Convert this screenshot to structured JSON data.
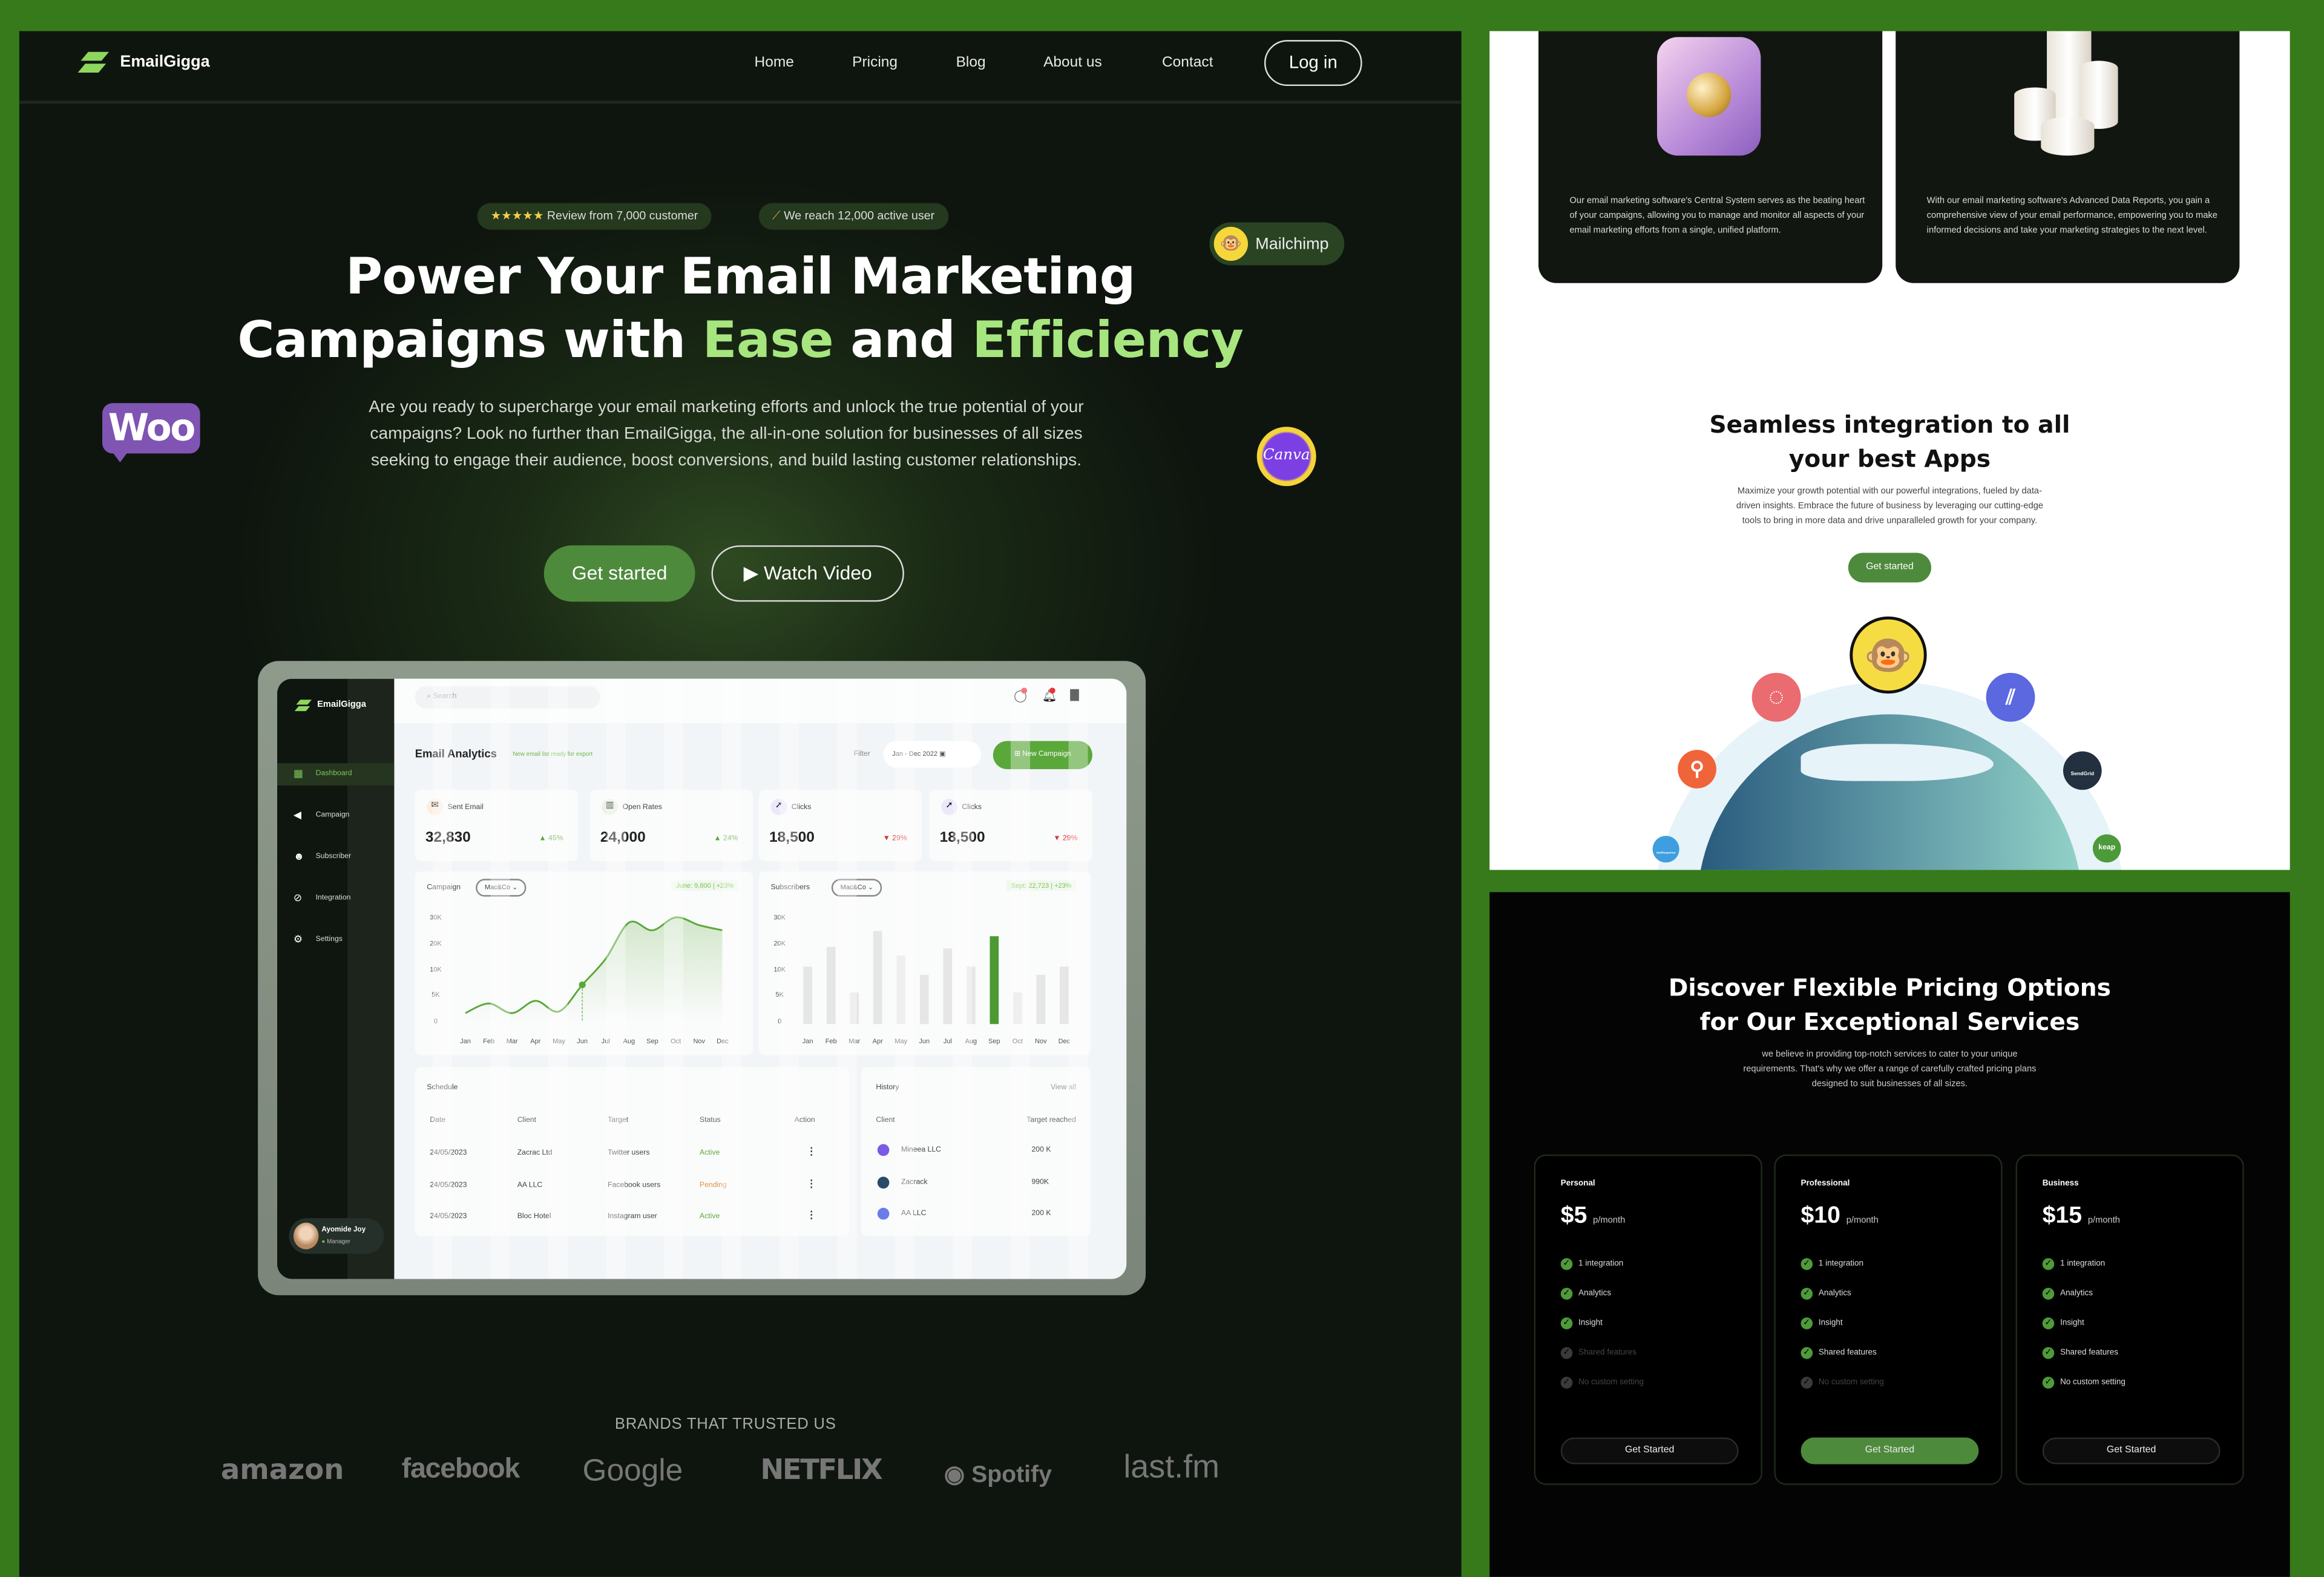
{
  "colors": {
    "page_bg": "#367a1b",
    "accent_green": "#a7e57e",
    "button_green": "#4e8a3c",
    "hero_bg": "#0e150e"
  },
  "nav": {
    "brand": "EmailGigga",
    "links": [
      "Home",
      "Pricing",
      "Blog",
      "About us",
      "Contact"
    ],
    "login": "Log in"
  },
  "hero": {
    "badge_reviews": {
      "stars": "★★★★★",
      "text": "Review from 7,000 customer"
    },
    "badge_users": {
      "icon": "party-popper-icon",
      "text": "We reach 12,000 active user"
    },
    "title_line1": "Power Your Email Marketing",
    "title_line2_a": "Campaigns with ",
    "title_ease": "Ease",
    "title_and": " and ",
    "title_efficiency": "Efficiency",
    "paragraph": "Are you ready to supercharge your email marketing efforts and unlock the true potential of your campaigns? Look no further than EmailGigga, the all-in-one solution for businesses of all sizes seeking to engage their audience, boost conversions, and build lasting customer relationships.",
    "get_started": "Get started",
    "watch_video": "Watch Video",
    "floating": {
      "mailchimp": "Mailchimp",
      "woo": "Woo",
      "canva": "Canva"
    }
  },
  "dashboard": {
    "brand": "EmailGigga",
    "search_placeholder": "Search",
    "sidebar": [
      {
        "label": "Dashboard",
        "icon": "grid-icon",
        "active": true
      },
      {
        "label": "Campaign",
        "icon": "megaphone-icon"
      },
      {
        "label": "Subscriber",
        "icon": "users-icon"
      },
      {
        "label": "Integration",
        "icon": "link-icon"
      },
      {
        "label": "Settings",
        "icon": "gear-icon"
      }
    ],
    "user": {
      "name": "Ayomide Joy",
      "role": "Manager"
    },
    "title": "Email Analytics",
    "notice": "New email list ready for export",
    "filter_label": "Filter",
    "date_range": "Jan - Dec 2022",
    "new_campaign": "New Campaign",
    "stats": [
      {
        "label": "Sent Email",
        "value": "32,830",
        "change": "▲ 45%",
        "trend": "up"
      },
      {
        "label": "Open Rates",
        "value": "24,000",
        "change": "▲ 24%",
        "trend": "up"
      },
      {
        "label": "Clicks",
        "value": "18,500",
        "change": "▼ 29%",
        "trend": "down"
      },
      {
        "label": "Clicks",
        "value": "18,500",
        "change": "▼ 29%",
        "trend": "down"
      }
    ],
    "schedule": {
      "title": "Schedule",
      "columns": [
        "Date",
        "Client",
        "Target",
        "Status",
        "Action"
      ],
      "rows": [
        [
          "24/05/2023",
          "Zacrac Ltd",
          "Twitter users",
          "Active"
        ],
        [
          "24/05/2023",
          "AA LLC",
          "Facebook users",
          "Pending"
        ],
        [
          "24/05/2023",
          "Bloc Hotel",
          "Instagram user",
          "Active"
        ]
      ]
    },
    "history": {
      "title": "History",
      "view_all": "View all",
      "columns": [
        "Client",
        "Target reached"
      ],
      "rows": [
        [
          "Mineea LLC",
          "200 K"
        ],
        [
          "Zacrack",
          "990K"
        ],
        [
          "AA LLC",
          "200 K"
        ]
      ]
    }
  },
  "chart_data": [
    {
      "type": "area",
      "title": "Campaign",
      "dropdown": "Mac&Co",
      "annotation": "June: 9,800 | +23%",
      "categories": [
        "Jan",
        "Feb",
        "Mar",
        "Apr",
        "May",
        "Jun",
        "Jul",
        "Aug",
        "Sep",
        "Oct",
        "Nov",
        "Dec"
      ],
      "values": [
        1500,
        3300,
        1500,
        3800,
        1800,
        6900,
        14000,
        28000,
        25000,
        30000,
        27000,
        25000
      ],
      "yticks": [
        "0",
        "5K",
        "10K",
        "20K",
        "30K"
      ],
      "ylim": [
        0,
        30000
      ],
      "highlight": "Jun",
      "color": "#5aa83a"
    },
    {
      "type": "bar",
      "title": "Subscribers",
      "dropdown": "Mac&Co",
      "annotation": "Sept: 22,723 | +23%",
      "categories": [
        "Jan",
        "Feb",
        "Mar",
        "Apr",
        "May",
        "Jun",
        "Jul",
        "Aug",
        "Sep",
        "Oct",
        "Nov",
        "Dec"
      ],
      "values": [
        11000,
        18600,
        5400,
        24700,
        15300,
        8900,
        18000,
        11000,
        22723,
        5400,
        8900,
        11000
      ],
      "yticks": [
        "0",
        "5K",
        "10K",
        "20K",
        "30K"
      ],
      "ylim": [
        0,
        30000
      ],
      "highlight": "Sep",
      "color": "#4d9a35",
      "bar_color": "#e6e6e6"
    }
  ],
  "brands": {
    "title": "BRANDS THAT TRUSTED US",
    "items": [
      "amazon",
      "facebook",
      "Google",
      "NETFLIX",
      "Spotify",
      "last.fm"
    ]
  },
  "features": [
    {
      "text": "Our email marketing software's Central System serves as the beating heart of your campaigns, allowing you to manage and monitor all aspects of your email marketing efforts from a single, unified platform."
    },
    {
      "text": "With our email marketing software's Advanced Data Reports, you gain a comprehensive view of your email performance, empowering you to make informed decisions and take your marketing strategies to the next level."
    }
  ],
  "integration": {
    "title_line1": "Seamless integration to all",
    "title_line2": "your best Apps",
    "paragraph": "Maximize your growth potential with our powerful integrations, fueled by data-driven insights. Embrace the future of business by leveraging our cutting-edge tools to bring in more data and drive unparalleled growth for your company.",
    "button": "Get started",
    "logos": {
      "sendgrid": "SendGrid",
      "keap": "keap",
      "getresponse": "GetResponse"
    }
  },
  "pricing": {
    "title_line1": "Discover Flexible Pricing Options",
    "title_line2": "for Our Exceptional Services",
    "paragraph": "we believe in providing top-notch services to cater to your unique requirements. That's why we offer a range of carefully crafted pricing plans designed to suit businesses of all sizes.",
    "plans": [
      {
        "name": "Personal",
        "price": "$5",
        "period": "p/month",
        "features": [
          [
            "1 integration",
            true
          ],
          [
            "Analytics",
            true
          ],
          [
            "Insight",
            true
          ],
          [
            "Shared features",
            false
          ],
          [
            "No custom setting",
            false
          ]
        ],
        "button": "Get Started",
        "highlight": false
      },
      {
        "name": "Professional",
        "price": "$10",
        "period": "p/month",
        "features": [
          [
            "1 integration",
            true
          ],
          [
            "Analytics",
            true
          ],
          [
            "Insight",
            true
          ],
          [
            "Shared features",
            true
          ],
          [
            "No custom setting",
            false
          ]
        ],
        "button": "Get Started",
        "highlight": true
      },
      {
        "name": "Business",
        "price": "$15",
        "period": "p/month",
        "features": [
          [
            "1 integration",
            true
          ],
          [
            "Analytics",
            true
          ],
          [
            "Insight",
            true
          ],
          [
            "Shared features",
            true
          ],
          [
            "No custom setting",
            true
          ]
        ],
        "button": "Get Started",
        "highlight": false
      }
    ]
  }
}
